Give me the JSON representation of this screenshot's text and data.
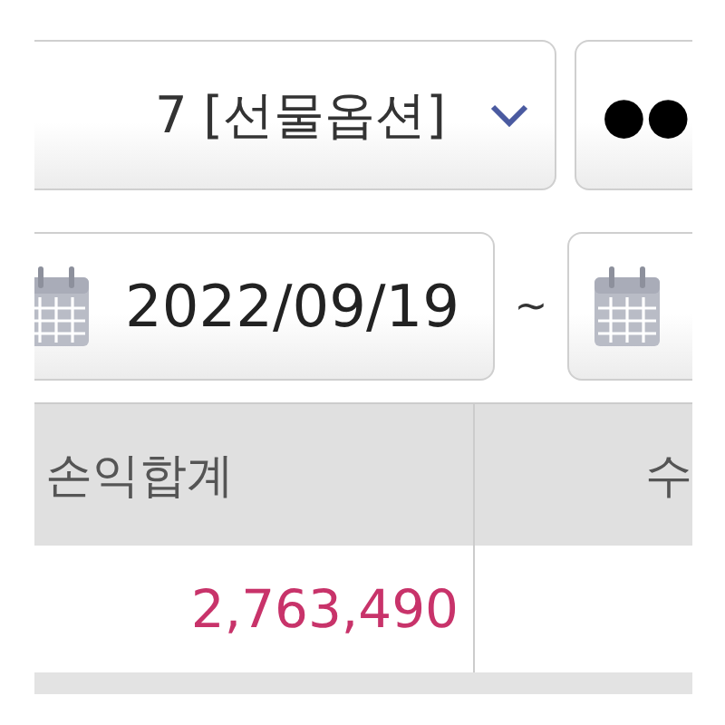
{
  "account_select": {
    "value": "7 [선물옵션]"
  },
  "password_field": {
    "value": "●●"
  },
  "date_range": {
    "start": "2022/09/19",
    "separator": "~"
  },
  "table": {
    "columns": [
      "손익합계",
      "수"
    ],
    "rows": [
      [
        "2,763,490",
        ""
      ]
    ]
  }
}
